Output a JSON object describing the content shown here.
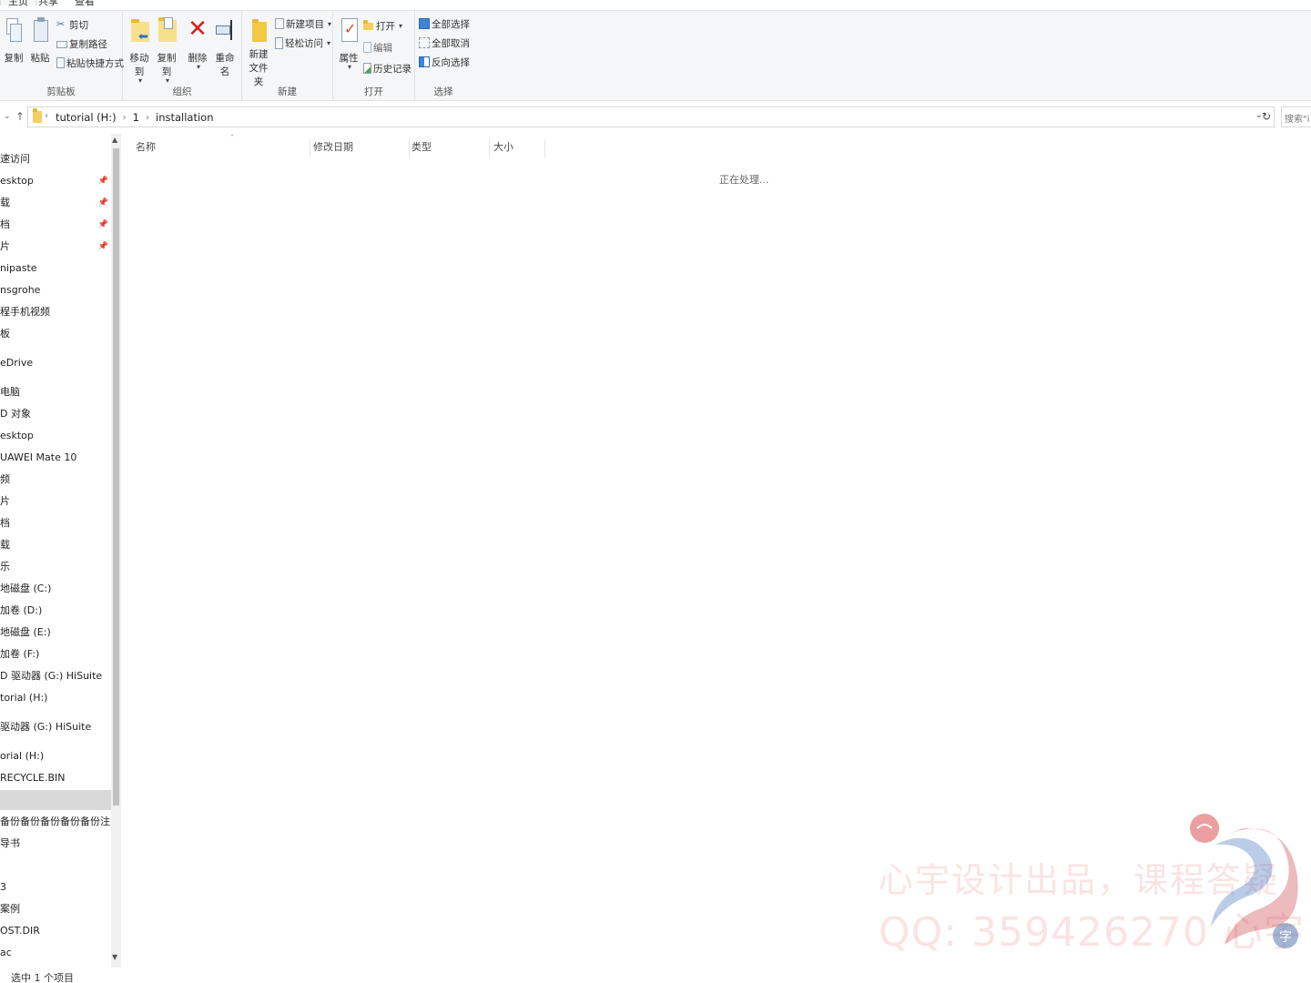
{
  "tabs": [
    {
      "label": "主页"
    },
    {
      "label": "共享"
    },
    {
      "label": "查看"
    }
  ],
  "ribbon": {
    "clipboard": {
      "label": "剪贴板",
      "copy": "复制",
      "paste": "粘贴",
      "cut": "剪切",
      "copy_path": "复制路径",
      "paste_shortcut": "粘贴快捷方式"
    },
    "organize": {
      "label": "组织",
      "move_to": "移动到",
      "copy_to": "复制到",
      "delete": "删除",
      "rename": "重命名"
    },
    "new": {
      "label": "新建",
      "new_folder_line1": "新建",
      "new_folder_line2": "文件夹",
      "new_item": "新建项目",
      "easy_access": "轻松访问"
    },
    "open": {
      "label": "打开",
      "properties": "属性",
      "open": "打开",
      "edit": "编辑",
      "history": "历史记录"
    },
    "select": {
      "label": "选择",
      "select_all": "全部选择",
      "select_none": "全部取消",
      "invert": "反向选择"
    }
  },
  "address": {
    "crumbs": [
      "tutorial (H:)",
      "1",
      "installation"
    ],
    "search_placeholder": "搜索\"i"
  },
  "nav": {
    "items": [
      {
        "label": "速访问",
        "pinned": false
      },
      {
        "label": "esktop",
        "pinned": true
      },
      {
        "label": "载",
        "pinned": true
      },
      {
        "label": "档",
        "pinned": true
      },
      {
        "label": "片",
        "pinned": true
      },
      {
        "label": "nipaste",
        "pinned": false
      },
      {
        "label": "nsgrohe",
        "pinned": false
      },
      {
        "label": "程手机视频",
        "pinned": false
      },
      {
        "label": "板",
        "pinned": false
      },
      {
        "label": "eDrive",
        "pinned": false
      },
      {
        "label": "电脑",
        "pinned": false
      },
      {
        "label": "D 对象",
        "pinned": false
      },
      {
        "label": "esktop",
        "pinned": false
      },
      {
        "label": "UAWEI Mate 10",
        "pinned": false
      },
      {
        "label": "频",
        "pinned": false
      },
      {
        "label": "片",
        "pinned": false
      },
      {
        "label": "档",
        "pinned": false
      },
      {
        "label": "载",
        "pinned": false
      },
      {
        "label": "乐",
        "pinned": false
      },
      {
        "label": "地磁盘 (C:)",
        "pinned": false
      },
      {
        "label": "加卷 (D:)",
        "pinned": false
      },
      {
        "label": "地磁盘 (E:)",
        "pinned": false
      },
      {
        "label": "加卷 (F:)",
        "pinned": false
      },
      {
        "label": "D 驱动器 (G:) HiSuite",
        "pinned": false
      },
      {
        "label": "torial (H:)",
        "pinned": false
      },
      {
        "label": "驱动器 (G:) HiSuite",
        "pinned": false
      },
      {
        "label": "orial (H:)",
        "pinned": false
      },
      {
        "label": "RECYCLE.BIN",
        "pinned": false
      },
      {
        "label": "",
        "pinned": false,
        "selected": true
      },
      {
        "label": "备份备份备份备份备份注意别摸",
        "pinned": false
      },
      {
        "label": "导书",
        "pinned": false
      },
      {
        "label": "",
        "pinned": false
      },
      {
        "label": "3",
        "pinned": false
      },
      {
        "label": "案例",
        "pinned": false
      },
      {
        "label": "OST.DIR",
        "pinned": false
      },
      {
        "label": "ac",
        "pinned": false
      }
    ]
  },
  "columns": [
    {
      "label": "名称"
    },
    {
      "label": "修改日期"
    },
    {
      "label": "类型"
    },
    {
      "label": "大小"
    }
  ],
  "content": {
    "processing": "正在处理..."
  },
  "status": {
    "text": "选中 1 个项目"
  },
  "watermark": {
    "line1": "心宇设计出品，课程答疑",
    "line2": "QQ: 359426270 心宇"
  },
  "colors": {
    "ribbon_bg": "#f5f6f7",
    "selected_row": "#d9d9d9",
    "folder_yellow": "#f4cf5d",
    "delete_red": "#d41f1f",
    "watermark_red": "#e65050"
  }
}
